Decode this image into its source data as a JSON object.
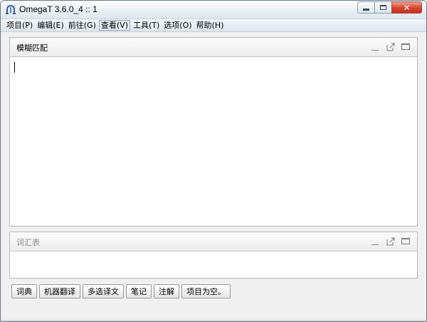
{
  "window": {
    "title": "OmegaT 3.6.0_4 :: 1",
    "icons": {
      "app": "omegat-logo-icon",
      "minimize": "minimize-icon",
      "maximize": "maximize-icon",
      "close": "close-icon"
    },
    "close_label": "✕"
  },
  "menu": {
    "items": [
      {
        "label": "项目(P)"
      },
      {
        "label": "编辑(E)"
      },
      {
        "label": "前往(G)"
      },
      {
        "label": "查看(V)"
      },
      {
        "label": "工具(T)"
      },
      {
        "label": "选项(O)"
      },
      {
        "label": "帮助(H)"
      }
    ],
    "highlighted": "查看(V)"
  },
  "panels": {
    "fuzzy": {
      "title": "模糊匹配",
      "content": ""
    },
    "glossary": {
      "title": "词汇表",
      "content": ""
    },
    "panel_icons": [
      "minimize-panel-icon",
      "undock-icon",
      "maximize-panel-icon"
    ]
  },
  "tabs": [
    {
      "label": "词典"
    },
    {
      "label": "机器翻译"
    },
    {
      "label": "多选译文"
    },
    {
      "label": "笔记"
    },
    {
      "label": "注解"
    },
    {
      "label": "项目为空。"
    }
  ],
  "colors": {
    "close_button": "#d2432f",
    "frame": "#6b7b8c",
    "panel_border": "#b9b9b9"
  }
}
